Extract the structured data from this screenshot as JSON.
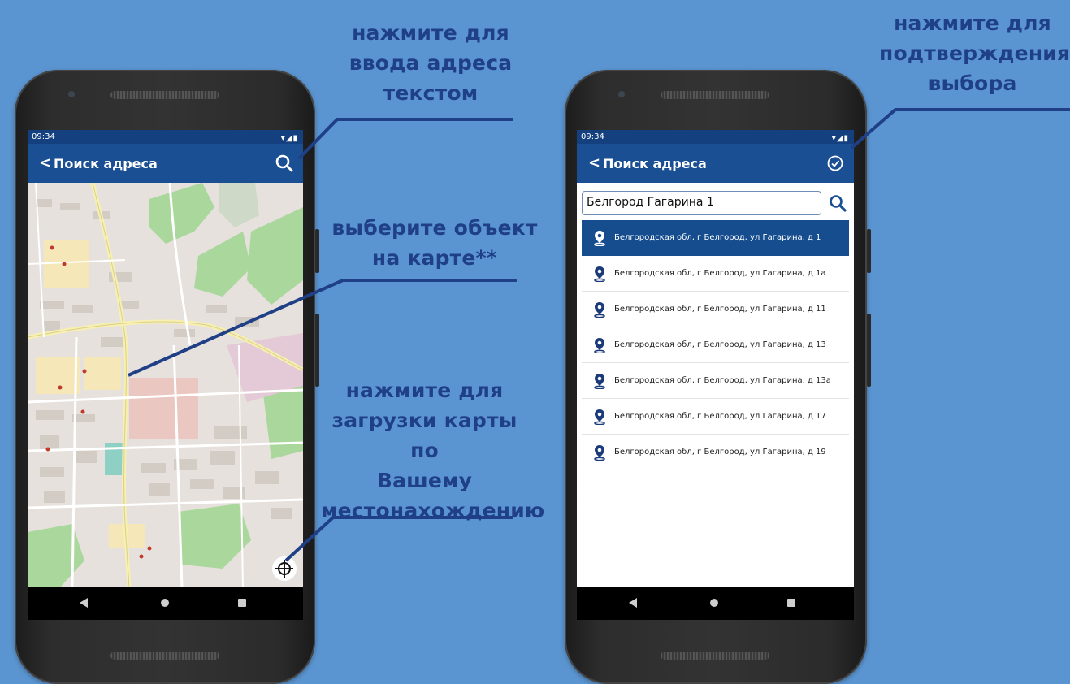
{
  "colors": {
    "background": "#5b95d1",
    "callout_text": "#1f3f86",
    "app_bar": "#1a4f93",
    "status_bar": "#14407f",
    "selected_row": "#164d8f"
  },
  "callouts": {
    "left_search": [
      "нажмите для",
      "ввода адреса",
      "текстом"
    ],
    "left_map": [
      "выберите объект",
      "на карте**"
    ],
    "left_location": [
      "нажмите для",
      "загрузки карты по",
      "Вашему",
      "местонахождению"
    ],
    "right_confirm": [
      "нажмите для",
      "подтверждения",
      "выбора"
    ]
  },
  "left_phone": {
    "status_time": "09:34",
    "app_bar": {
      "back_icon": "chevron-left-icon",
      "title": "Поиск адреса",
      "action_icon": "search-icon"
    },
    "map": {
      "locate_icon": "crosshair-icon"
    },
    "nav_icons": [
      "back-triangle-icon",
      "home-circle-icon",
      "recents-square-icon"
    ]
  },
  "right_phone": {
    "status_time": "09:34",
    "app_bar": {
      "back_icon": "chevron-left-icon",
      "title": "Поиск адреса",
      "action_icon": "check-circle-icon"
    },
    "search": {
      "value": "Белгород Гагарина 1",
      "button_icon": "search-icon"
    },
    "results": [
      {
        "label": "Белгородская обл, г Белгород, ул Гагарина, д 1",
        "selected": true
      },
      {
        "label": "Белгородская обл, г Белгород, ул Гагарина, д 1а",
        "selected": false
      },
      {
        "label": "Белгородская обл, г Белгород, ул Гагарина, д 11",
        "selected": false
      },
      {
        "label": "Белгородская обл, г Белгород, ул Гагарина, д 13",
        "selected": false
      },
      {
        "label": "Белгородская обл, г Белгород, ул Гагарина, д 13а",
        "selected": false
      },
      {
        "label": "Белгородская обл, г Белгород, ул Гагарина, д 17",
        "selected": false
      },
      {
        "label": "Белгородская обл, г Белгород, ул Гагарина, д 19",
        "selected": false
      }
    ],
    "nav_icons": [
      "back-triangle-icon",
      "home-circle-icon",
      "recents-square-icon"
    ]
  }
}
